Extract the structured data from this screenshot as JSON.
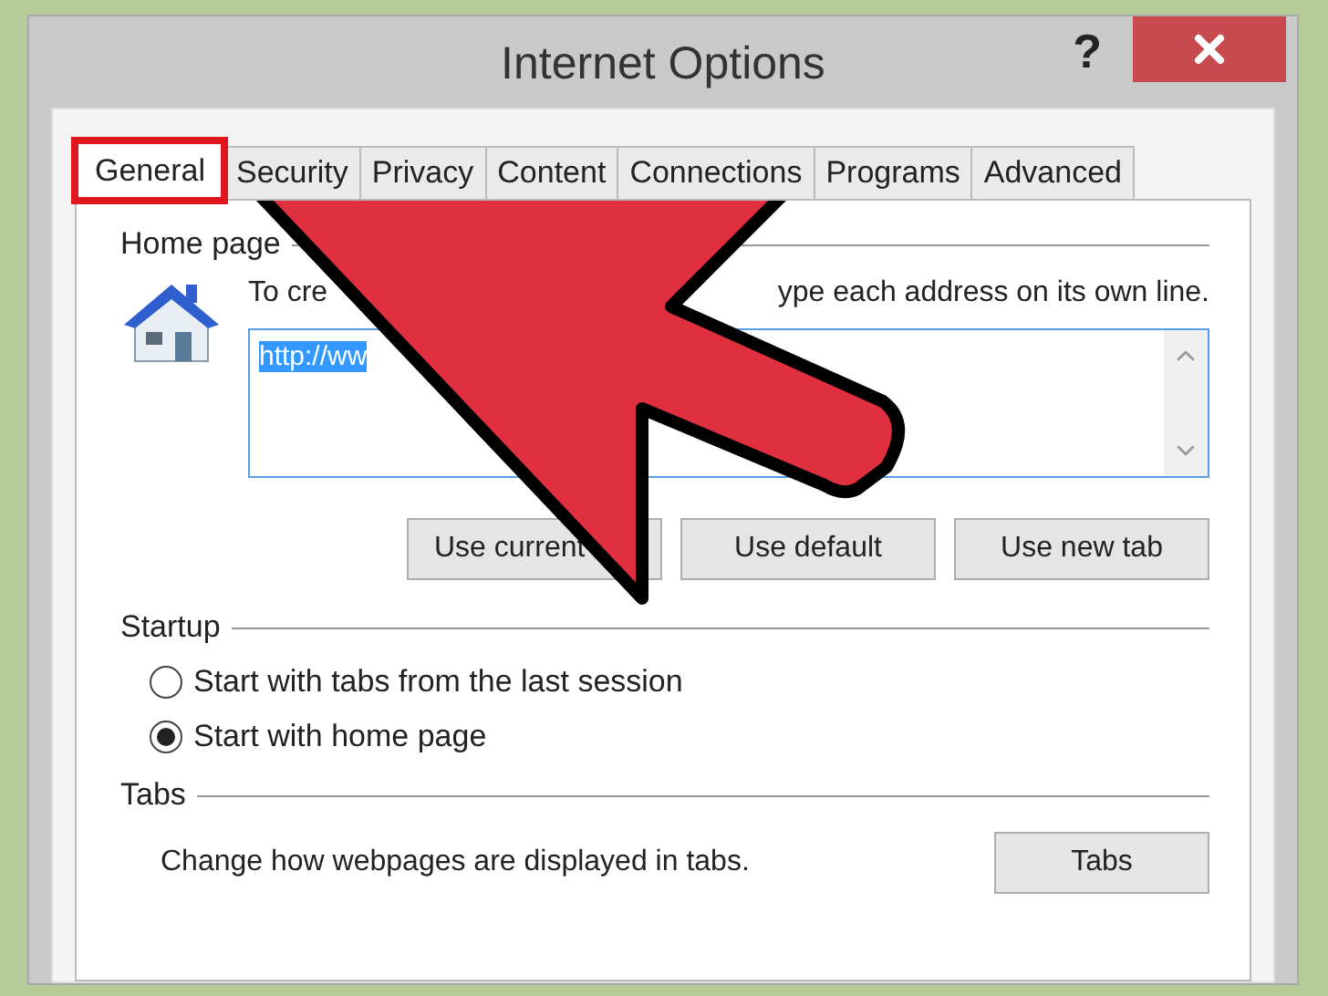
{
  "window": {
    "title": "Internet Options",
    "help": "?"
  },
  "tabs": [
    {
      "label": "General",
      "selected": true,
      "highlighted": true
    },
    {
      "label": "Security",
      "selected": false,
      "highlighted": false
    },
    {
      "label": "Privacy",
      "selected": false,
      "highlighted": false
    },
    {
      "label": "Content",
      "selected": false,
      "highlighted": false
    },
    {
      "label": "Connections",
      "selected": false,
      "highlighted": false
    },
    {
      "label": "Programs",
      "selected": false,
      "highlighted": false
    },
    {
      "label": "Advanced",
      "selected": false,
      "highlighted": false
    }
  ],
  "home_page": {
    "heading": "Home page",
    "instruction_parts": [
      "To cre",
      "ype each address on its own line."
    ],
    "url": "http://ww",
    "url_selected": true,
    "buttons": [
      "Use current",
      "Use default",
      "Use new tab"
    ]
  },
  "startup": {
    "heading": "Startup",
    "options": [
      {
        "label": "Start with tabs from the last session",
        "selected": false
      },
      {
        "label": "Start with home page",
        "selected": true
      }
    ]
  },
  "tabs_section": {
    "heading": "Tabs",
    "description": "Change how webpages are displayed in tabs.",
    "button": "Tabs"
  }
}
